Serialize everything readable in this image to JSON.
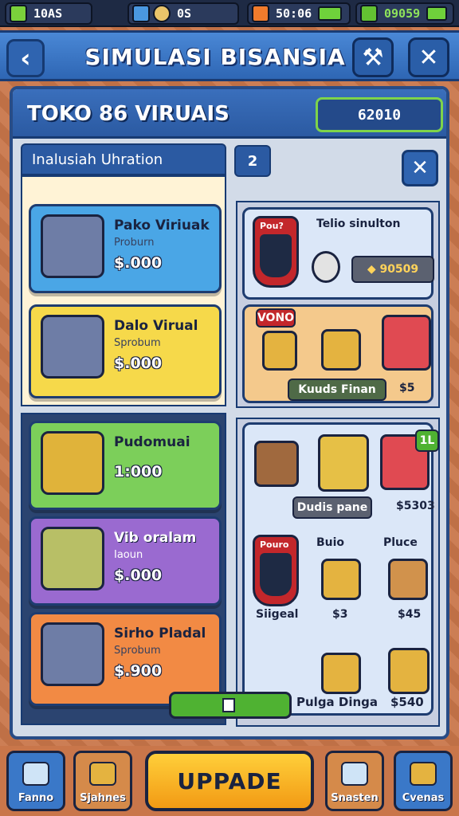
{
  "topbar": {
    "resources": [
      {
        "icon": "gem-icon",
        "value": "10AS",
        "color": "#7ad13b"
      },
      {
        "icon": "cube-icon",
        "value": "0S",
        "color": "#4a98e0"
      },
      {
        "icon": "clock-icon",
        "value": "50:06",
        "color": "#f07b2c"
      },
      {
        "icon": "cash-icon",
        "value": "09059",
        "color": "#63c132"
      }
    ]
  },
  "header": {
    "title": "SIMULASI BISANSIA",
    "back_icon": "chevron-left-icon",
    "tool_icon": "wrench-icon",
    "close_icon": "close-icon"
  },
  "panel": {
    "title": "TOKO 86  VIRUAIS",
    "money": "62010",
    "subhead": "Inalusiah Uhration",
    "count": "2"
  },
  "left_cards": [
    {
      "name": "Pako Viriuak",
      "sub": "Proburn",
      "price": "$.000",
      "color": "#4aa6e6",
      "art_color": "#6e7da6"
    },
    {
      "name": "Dalo Virual",
      "sub": "Sprobum",
      "price": "$.000",
      "color": "#f6d94a",
      "art_color": "#6e7da6"
    },
    {
      "name": "Pudomuai",
      "sub": "",
      "price": "1:000",
      "color": "#7ccf5a",
      "art_color": "#e0b33a"
    },
    {
      "name": "Vib oralam",
      "sub": "Iaoun",
      "price": "$.000",
      "color": "#9a6ad0",
      "art_color": "#b8bf66"
    },
    {
      "name": "Sirho Pladal",
      "sub": "Sprobum",
      "price": "$.900",
      "color": "#f28a44",
      "art_color": "#6e7da6"
    }
  ],
  "right_top": {
    "shield_tag": "Pou?",
    "title": "Telio sinulton",
    "price_pill": "◆ 90509",
    "vono_tag": "VONO",
    "pill": "Kuuds Finan",
    "price": "$5"
  },
  "right_bottom": {
    "badge": "1L",
    "pill": "Dudis pane",
    "price1": "$5303",
    "shield_tag": "Pouro",
    "shield_label": "Siigeal",
    "item_a": "Buio",
    "item_b": "Pluce",
    "price_a": "$3",
    "price_b": "$45",
    "progress_label": "Pulga Dinga",
    "progress_price": "$540",
    "progress_fraction": 0.45
  },
  "bottom_nav": {
    "items": [
      {
        "label": "Fanno",
        "color": "#3a78c8",
        "icon": "hammer-icon"
      },
      {
        "label": "Sjahnes",
        "color": "#d58a4a",
        "icon": "box-icon"
      },
      {
        "label": "Snasten",
        "color": "#d58a4a",
        "icon": "tools-icon"
      },
      {
        "label": "Cvenas",
        "color": "#3a78c8",
        "icon": "crate-icon"
      }
    ],
    "upgrade_label": "UPPADE"
  }
}
